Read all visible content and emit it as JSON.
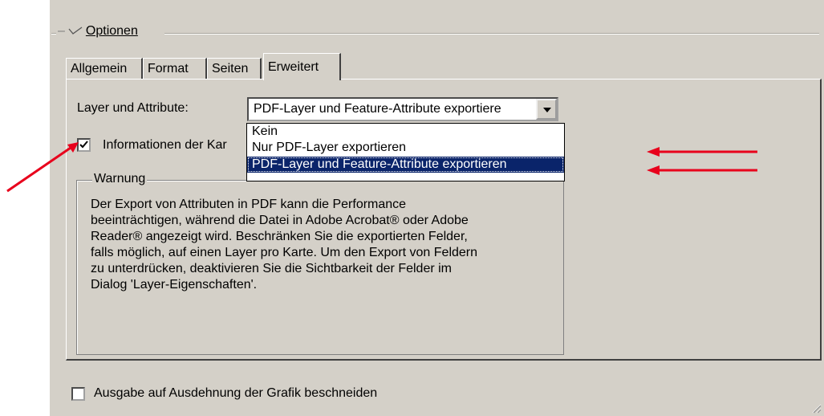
{
  "options": {
    "title_prefix": "–",
    "title": "Optionen"
  },
  "tabs": [
    {
      "label": "Allgemein"
    },
    {
      "label": "Format"
    },
    {
      "label": "Seiten"
    },
    {
      "label": "Erweitert"
    }
  ],
  "layer": {
    "label": "Layer und Attribute:",
    "value": "PDF-Layer und Feature-Attribute exportiere",
    "options": [
      "Kein",
      "Nur PDF-Layer exportieren",
      "PDF-Layer und Feature-Attribute exportieren"
    ]
  },
  "info_checkbox": {
    "label": "Informationen der Kar",
    "checked": true
  },
  "warning": {
    "legend": "Warnung",
    "lines": [
      "Der Export von Attributen in PDF kann die Performance",
      "beeinträchtigen, während die Datei in Adobe Acrobat® oder Adobe",
      "Reader® angezeigt wird.  Beschränken Sie die exportierten Felder,",
      "falls möglich, auf einen Layer pro Karte. Um den Export von Feldern",
      "zu unterdrücken, deaktivieren Sie die Sichtbarkeit der Felder im",
      "Dialog 'Layer-Eigenschaften'."
    ]
  },
  "clip_checkbox": {
    "label": "Ausgabe auf Ausdehnung der Grafik beschneiden",
    "checked": false
  },
  "colors": {
    "panel": "#d4d0c8",
    "selection": "#0a246a",
    "annotation_arrow": "#e8001c"
  }
}
